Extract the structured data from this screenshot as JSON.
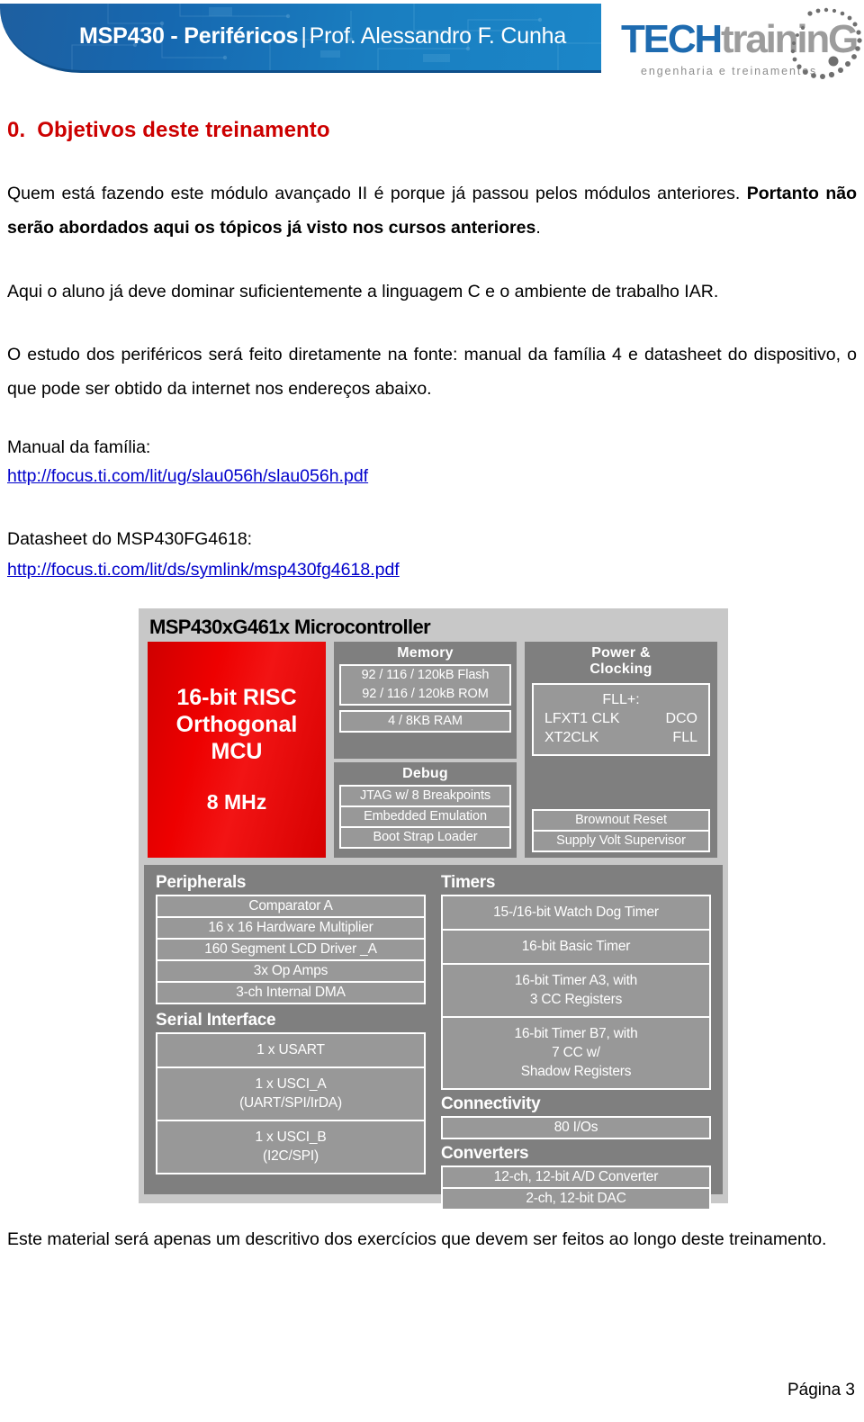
{
  "header": {
    "banner_title_bold": "MSP430 - Periféricos",
    "banner_title_sep": "|",
    "banner_title_light": "Prof. Alessandro F. Cunha",
    "logo_tech": "TECH",
    "logo_training": "traininG",
    "logo_tagline": "engenharia e treinamentos"
  },
  "content": {
    "heading_number": "0.",
    "heading_text": "Objetivos deste treinamento",
    "para_quem": "Quem está fazendo este módulo avançado II é porque já passou pelos módulos anteriores.",
    "para_quem_bold": "Portanto não serão abordados aqui os tópicos já visto nos cursos anteriores",
    "para_quem_end": ".",
    "para_aqui": "Aqui o aluno já deve dominar suficientemente a linguagem C e o ambiente de trabalho IAR.",
    "para_estudo": "O estudo dos periféricos será feito diretamente na fonte: manual da família 4 e datasheet do dispositivo, o que pode ser obtido da internet nos endereços abaixo.",
    "manual_label": "Manual da família:",
    "manual_link": "http://focus.ti.com/lit/ug/slau056h/slau056h.pdf",
    "datasheet_label": "Datasheet do MSP430FG4618:",
    "datasheet_link": "http://focus.ti.com/lit/ds/symlink/msp430fg4618.pdf",
    "para_final": "Este material será apenas um descritivo dos exercícios que devem ser feitos ao longo deste treinamento.",
    "page_number": "Página 3"
  },
  "diagram": {
    "title": "MSP430xG461x Microcontroller",
    "core": {
      "line1": "16-bit RISC",
      "line2": "Orthogonal",
      "line3": "MCU",
      "speed": "8 MHz"
    },
    "memory": {
      "title": "Memory",
      "rows": [
        "92 / 116 / 120kB Flash",
        "92 / 116 / 120kB ROM"
      ],
      "ram": "4 / 8KB RAM"
    },
    "debug": {
      "title": "Debug",
      "rows": [
        "JTAG w/ 8 Breakpoints",
        "Embedded Emulation",
        "Boot Strap Loader"
      ]
    },
    "power": {
      "title_line1": "Power &",
      "title_line2": "Clocking",
      "fll_title": "FLL+:",
      "fll_left1": "LFXT1 CLK",
      "fll_right1": "DCO",
      "fll_left2": "XT2CLK",
      "fll_right2": "FLL",
      "rows": [
        "Brownout Reset",
        "Supply Volt Supervisor"
      ]
    },
    "peripherals": {
      "title": "Peripherals",
      "rows": [
        "Comparator A",
        "16 x 16 Hardware Multiplier",
        "160 Segment LCD Driver _A",
        "3x Op Amps",
        "3-ch Internal DMA"
      ]
    },
    "serial": {
      "title_bold": "Serial",
      "title_rest": " Interface",
      "rows": [
        "1 x USART",
        "1 x USCI_A\n(UART/SPI/IrDA)",
        "1 x USCI_B\n(I2C/SPI)"
      ]
    },
    "timers": {
      "title": "Timers",
      "rows": [
        "15-/16-bit Watch Dog Timer",
        "16-bit Basic Timer",
        "16-bit Timer A3, with\n3 CC Registers",
        "16-bit Timer B7, with\n7 CC w/\nShadow Registers"
      ]
    },
    "connectivity": {
      "title": "Connectivity",
      "rows": [
        "80 I/Os"
      ]
    },
    "converters": {
      "title": "Converters",
      "rows": [
        "12-ch, 12-bit A/D Converter",
        "2-ch, 12-bit DAC"
      ]
    }
  },
  "colors": {
    "heading_red": "#cc0000",
    "link_blue": "#0000cc",
    "banner_blue": "#1668b0",
    "logo_blue": "#1e6bb0",
    "core_red": "#ee0000"
  }
}
